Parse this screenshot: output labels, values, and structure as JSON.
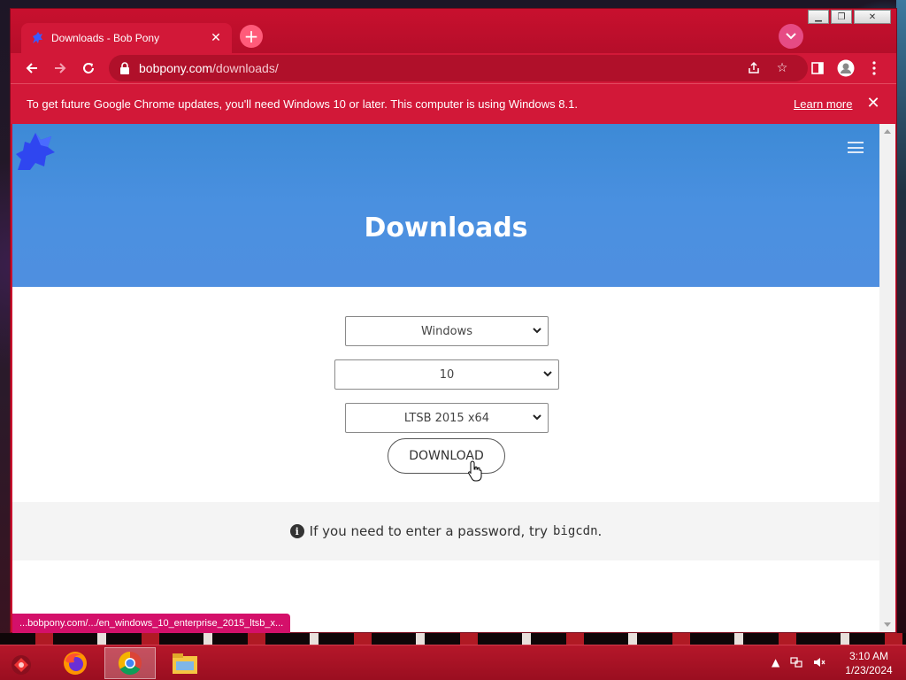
{
  "browser": {
    "tab_title": "Downloads - Bob Pony",
    "url_domain": "bobpony.com",
    "url_path": "/downloads/",
    "colors": {
      "frame": "#c8102e",
      "toolbar": "#d21838",
      "omnibox": "#b0102a"
    }
  },
  "infobar": {
    "message": "To get future Google Chrome updates, you'll need Windows 10 or later. This computer is using Windows 8.1.",
    "link": "Learn more"
  },
  "page": {
    "hero_title": "Downloads",
    "hero_color": "#4a90e0",
    "os_select": "Windows",
    "version_select": "10",
    "edition_select": "LTSB 2015 x64",
    "download_button": "DOWNLOAD",
    "notice_prefix": "If you need to enter a password, try",
    "notice_code": "bigcdn",
    "notice_suffix": "."
  },
  "status_bar": {
    "link_preview": "...bobpony.com/.../en_windows_10_enterprise_2015_ltsb_x..."
  },
  "taskbar": {
    "apps": [
      "firefox-icon",
      "chrome-icon",
      "file-explorer-icon"
    ],
    "time": "3:10 AM",
    "date": "1/23/2024"
  }
}
